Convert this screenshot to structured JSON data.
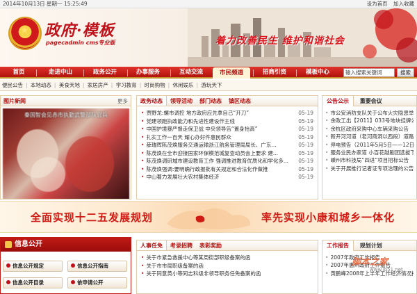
{
  "topbar": {
    "datetime": "2014年10月13日 星期一 15:25:49",
    "set_home": "设为首页",
    "add_fav": "加入收藏"
  },
  "banner": {
    "title": "政府·模板",
    "subtitle": "pagecadmin cms专业版",
    "slogan": "着力改善民生  维护和谐社会"
  },
  "nav": {
    "items": [
      "首页",
      "走进中山",
      "政务公开",
      "办事服务",
      "互动交流",
      "市民频道",
      "招商引资",
      "模板中心"
    ],
    "active_index": 5,
    "search_placeholder": "输入搜索关键词",
    "search_button": "搜索"
  },
  "subnav": {
    "items": [
      "便民公告",
      "本地动态",
      "美食天地",
      "家居房产",
      "学习教育",
      "时尚购物",
      "休闲娱乐",
      "游玩天下"
    ]
  },
  "photo_news": {
    "title": "图片新闻",
    "more": "更多",
    "caption": "秦国智会见赤市执勤武警部队官兵"
  },
  "news": {
    "tabs": [
      "政务动态",
      "领导活动",
      "部门动态",
      "镇区动态"
    ],
    "items": [
      {
        "title": "贾野龙:螺市调控  地方政府应先拿自己“开刀”",
        "date": "05-19"
      },
      {
        "title": "党建领跑执政能力和先进性建设作主线",
        "date": "05-19"
      },
      {
        "title": "中国护境暴严督走保卫战  中央领导告“置身抬高”",
        "date": "05-19"
      },
      {
        "title": "扎实工作一百天  耀心办好件惠民群众",
        "date": "05-19"
      },
      {
        "title": "薛瑞晖陈茂焕服务交通运输浙江航务管理局局长、广东...",
        "date": "05-19"
      },
      {
        "title": "陈茂焕在全市迎接国家环保模范城复查动员会上要求  建...",
        "date": "05-19"
      },
      {
        "title": "陈茂焕调研城市建设教育工作  强调推进教育优质化和学化多...",
        "date": "05-19"
      },
      {
        "title": "陈茂焕强调:要明确行政报批有关规定和合法化作做推",
        "date": "05-19"
      },
      {
        "title": "中山著力发展壮大农村集体经济",
        "date": "05-19"
      }
    ]
  },
  "notices": {
    "tabs": [
      "公告公示",
      "重要会议"
    ],
    "items": [
      "市公安消防支队关于公布火灾隐患举报",
      "余政工出【2011】033号地块挂牌公告",
      "余杭区政府采购中心车辆采购公告",
      "新开河河道（老河商洞以西段）道路工程",
      "停电预告（2011年5月5日——12日）",
      "服务业民办家道  小百花越剧团选拔下乡",
      "嵊州市科技局“四进”项目招标公告",
      "关于开展推行记者证专项治理的公告"
    ]
  },
  "ad": {
    "left": "全面实现十二五发展规划",
    "right": "率先实现小康和城乡一体化"
  },
  "info": {
    "title": "信息公开",
    "buttons": [
      "信息公开规定",
      "信息公开指南",
      "信息公开目录",
      "依申请公开"
    ]
  },
  "hr": {
    "tabs": [
      "人事任免",
      "考录招聘",
      "表彰奖励"
    ],
    "items": [
      "关于市紧急救援中心等某周街部职级备案的函",
      "关于市市局职级备案的函",
      "关于同意黄小等同志科级非领导职务任免备案的函"
    ]
  },
  "work": {
    "tabs": [
      "工作报告",
      "规划计划"
    ],
    "items": [
      "2007年政府工作报告",
      "2007年惠州政府工作报告",
      "黄鹏峰2008年上半年工作经济情况报告"
    ]
  },
  "watermark": {
    "text": "脚本之家",
    "url": "www.jb51.net"
  }
}
